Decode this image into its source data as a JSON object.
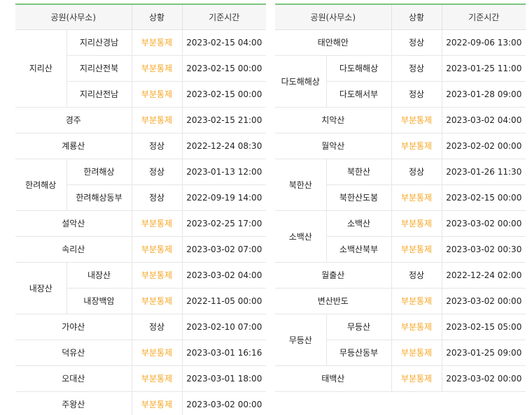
{
  "header": {
    "col_park": "공원(사무소)",
    "col_status": "상황",
    "col_time": "기준시간"
  },
  "colors": {
    "partial": "#f5a623",
    "normal": "#222222",
    "header_accent": "#7cc47f"
  },
  "left_table": [
    {
      "park": "지리산",
      "subs": [
        {
          "name": "지리산경남",
          "status": "부분통제",
          "type": "partial",
          "time": "2023-02-15 04:00"
        },
        {
          "name": "지리산전북",
          "status": "부분통제",
          "type": "partial",
          "time": "2023-02-15 00:00"
        },
        {
          "name": "지리산전남",
          "status": "부분통제",
          "type": "partial",
          "time": "2023-02-15 00:00"
        }
      ]
    },
    {
      "park": "경주",
      "status": "부분통제",
      "type": "partial",
      "time": "2023-02-15 21:00"
    },
    {
      "park": "계룡산",
      "status": "정상",
      "type": "normal",
      "time": "2022-12-24 08:30"
    },
    {
      "park": "한려해상",
      "subs": [
        {
          "name": "한려해상",
          "status": "정상",
          "type": "normal",
          "time": "2023-01-13 12:00"
        },
        {
          "name": "한려해상동부",
          "status": "정상",
          "type": "normal",
          "time": "2022-09-19 14:00"
        }
      ]
    },
    {
      "park": "설악산",
      "status": "부분통제",
      "type": "partial",
      "time": "2023-02-25 17:00"
    },
    {
      "park": "속리산",
      "status": "부분통제",
      "type": "partial",
      "time": "2023-03-02 07:00"
    },
    {
      "park": "내장산",
      "subs": [
        {
          "name": "내장산",
          "status": "부분통제",
          "type": "partial",
          "time": "2023-03-02 04:00"
        },
        {
          "name": "내장백암",
          "status": "부분통제",
          "type": "partial",
          "time": "2022-11-05 00:00"
        }
      ]
    },
    {
      "park": "가야산",
      "status": "정상",
      "type": "normal",
      "time": "2023-02-10 07:00"
    },
    {
      "park": "덕유산",
      "status": "부분통제",
      "type": "partial",
      "time": "2023-03-01 16:16"
    },
    {
      "park": "오대산",
      "status": "부분통제",
      "type": "partial",
      "time": "2023-03-01 18:00"
    },
    {
      "park": "주왕산",
      "status": "부분통제",
      "type": "partial",
      "time": "2023-03-02 00:00"
    }
  ],
  "right_table": [
    {
      "park": "태안해안",
      "status": "정상",
      "type": "normal",
      "time": "2022-09-06 13:00"
    },
    {
      "park": "다도해해상",
      "subs": [
        {
          "name": "다도해해상",
          "status": "정상",
          "type": "normal",
          "time": "2023-01-25 11:00"
        },
        {
          "name": "다도해서부",
          "status": "정상",
          "type": "normal",
          "time": "2023-01-28 09:00"
        }
      ]
    },
    {
      "park": "치악산",
      "status": "부분통제",
      "type": "partial",
      "time": "2023-03-02 04:00"
    },
    {
      "park": "월악산",
      "status": "부분통제",
      "type": "partial",
      "time": "2023-02-02 00:00"
    },
    {
      "park": "북한산",
      "subs": [
        {
          "name": "북한산",
          "status": "정상",
          "type": "normal",
          "time": "2023-01-26 11:30"
        },
        {
          "name": "북한산도봉",
          "status": "부분통제",
          "type": "partial",
          "time": "2023-02-15 00:00"
        }
      ]
    },
    {
      "park": "소백산",
      "subs": [
        {
          "name": "소백산",
          "status": "부분통제",
          "type": "partial",
          "time": "2023-03-02 00:00"
        },
        {
          "name": "소백산북부",
          "status": "부분통제",
          "type": "partial",
          "time": "2023-03-02 00:30"
        }
      ]
    },
    {
      "park": "월출산",
      "status": "정상",
      "type": "normal",
      "time": "2022-12-24 02:00"
    },
    {
      "park": "변산반도",
      "status": "부분통제",
      "type": "partial",
      "time": "2023-03-02 00:00"
    },
    {
      "park": "무등산",
      "subs": [
        {
          "name": "무등산",
          "status": "부분통제",
          "type": "partial",
          "time": "2023-02-15 05:00"
        },
        {
          "name": "무등산동부",
          "status": "부분통제",
          "type": "partial",
          "time": "2023-01-25 09:00"
        }
      ]
    },
    {
      "park": "태백산",
      "status": "부분통제",
      "type": "partial",
      "time": "2023-03-02 00:00"
    }
  ]
}
